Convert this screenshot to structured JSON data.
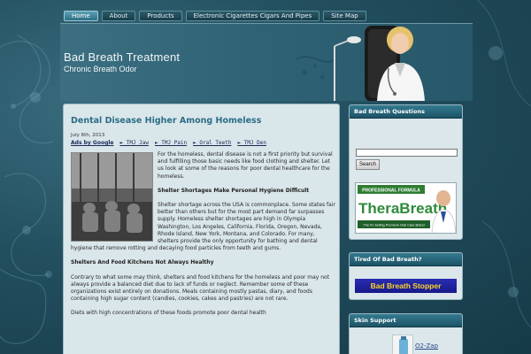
{
  "nav": {
    "items": [
      {
        "label": "Home",
        "active": true
      },
      {
        "label": "About",
        "active": false
      },
      {
        "label": "Products",
        "active": false
      },
      {
        "label": "Electronic Cigarettes Cigars And Pipes",
        "active": false
      },
      {
        "label": "Site Map",
        "active": false
      }
    ]
  },
  "header": {
    "title": "Bad Breath Treatment",
    "tagline": "Chronic Breath Odor"
  },
  "post": {
    "title": "Dental Disease Higher Among Homeless",
    "date": "July 6th, 2013",
    "ads_label": "Ads by Google",
    "ad_links": [
      "► TMJ Jaw",
      "► TMJ Pain",
      "► Oral Teeth",
      "► TMJ Den"
    ],
    "intro": "For the homeless, dental disease is not a first priority but survival and fulfilling those basic needs like food clothing and shelter. Let us look at some of the reasons for poor dental healthcare for the homeless.",
    "heading1": "Shelter Shortages Make Personal Hygiene Difficult",
    "para1": "Shelter shortage across the USA is commonplace. Some states fair better than others but for the most part demand far surpasses supply. Homeless shelter shortages are high in Olympia Washington, Los Angeles, California, Florida, Oregon, Nevada, Rhode Island, New York, Montana, and Colorado. For many, shelters provide the only opportunity for bathing and dental hygiene that remove rotting and decaying food particles from teeth and gums.",
    "heading2": "Shelters And Food Kitchens Not Always Healthy",
    "para2": "Contrary to what some may think, shelters and food kitchens for the homeless and poor may not always provide a balanced diet due to lack of funds or neglect. Remember some of these organizations exist entirely on donations. Meals containing mostly pastas, diary, and foods containing high sugar content (candies, cookies, cakes and pastries) are not rare.",
    "para3": "Diets with high concentrations of these foods promote poor dental health"
  },
  "sidebar": {
    "widget1": {
      "title": "Bad Breath Questions",
      "search_button": "Search",
      "ad_brand": "TheraBreath",
      "ad_top": "PROFESSIONAL FORMULA",
      "ad_sub": "The #1 Selling Premium Oral Care Brand"
    },
    "widget2": {
      "title": "Tired Of Bad Breath?",
      "banner": "Bad Breath Stopper"
    },
    "widget3": {
      "title": "Skin Support",
      "link": "O2-Zap"
    }
  }
}
